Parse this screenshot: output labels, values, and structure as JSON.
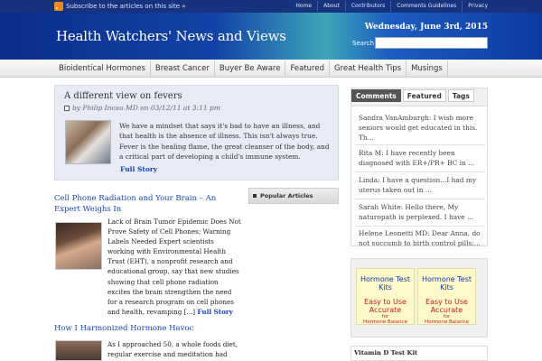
{
  "header": {
    "subscribe": "Subscribe to the articles on this site »",
    "top_links": [
      "Home",
      "About",
      "Contributors",
      "Comments Guidelines",
      "Privacy"
    ],
    "site_title": "Health Watchers' News and Views",
    "date": "Wednesday, June 3rd, 2015",
    "search_label": "Search",
    "search_value": ""
  },
  "nav": [
    "Bioidentical Hormones",
    "Breast Cancer",
    "Buyer Be Aware",
    "Featured",
    "Great Health Tips",
    "Musings"
  ],
  "featured": {
    "title": "A different view on fevers",
    "byline": "by Philip Incao MD on 03/12/11 at 3:11 pm",
    "text": "We have a mindset that says it's bad to have an illness, and that health is the absence of illness. This isn't always true. Fever is the healing flame, the great cleanser of the body, and a critical part of developing a child's immune system.",
    "more": "Full Story"
  },
  "articles": [
    {
      "title": "Cell Phone Radiation and Your Brain – An Expert Weighs In",
      "text": "Lack of Brain Tumor Epidemic Does Not Prove Safety of Cell Phones; Warning Labels Needed Expert scientists working with Environmental Health Trust (EHT), a nonprofit research and educational group, say that new studies showing that cell phone radiation excites the brain strengthen the need for a research program on cell phones and health, revamping [...]",
      "more": "Full Story"
    },
    {
      "title": "How I Harmonized Hormone Havoc",
      "text": "As I approached 50, a whole foods diet, regular exercise and meditation had been"
    }
  ],
  "popular_label": "Popular Articles",
  "sidebar": {
    "tabs": [
      "Comments",
      "Featured",
      "Tags"
    ],
    "comments": [
      "Sandra VanAmburgh: I wish more seniors would get educated in this. Th...",
      "Rita M: I have recently been diagnosed with ER+/PR+ BC in ...",
      "Linda: I have a question...I had my uterus taken out in ...",
      "Sarah White: Hello there, My naturopath is perplexed. I have ...",
      "Helene Leonetti MD: Dear Anna, do not succumb to birth control pills:..."
    ],
    "ads": [
      {
        "title": "Hormone Test Kits",
        "line1": "Easy to Use",
        "line2": "Accurate",
        "small1": "for",
        "small2": "Hormone Balance"
      },
      {
        "title": "Hormone Test Kits",
        "line1": "Easy to Use",
        "line2": "Accurate",
        "small1": "for",
        "small2": "Hormone Balance"
      }
    ],
    "vitd_title": "Vitamin D Test Kit"
  },
  "colors": {
    "brand_blue": "#17337e",
    "link": "#1a44b8",
    "ad_red": "#c41a1a"
  }
}
